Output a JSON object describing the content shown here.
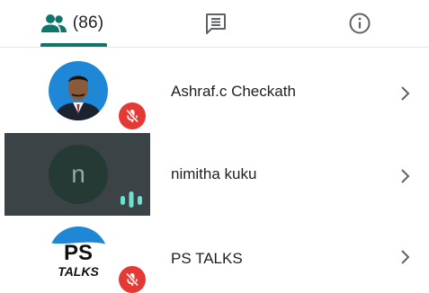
{
  "tabs": {
    "people": {
      "count_label": "(86)",
      "icon": "people-icon",
      "selected": true
    },
    "chat": {
      "icon": "chat-icon"
    },
    "info": {
      "icon": "info-icon"
    }
  },
  "colors": {
    "accent": "#11766a",
    "mic_muted": "#e53935",
    "speaking": "#6fe0d2",
    "speaking_tile": "#3b4346"
  },
  "participants": [
    {
      "name": "Ashraf.c Checkath",
      "avatar": "photo",
      "mic": "muted"
    },
    {
      "name": "nimitha kuku",
      "initial": "n",
      "mic": "speaking",
      "active_speaker": true
    },
    {
      "name": "PS TALKS",
      "avatar": "logo",
      "logo_text": [
        "PS",
        "TALKS"
      ],
      "mic": "muted"
    }
  ]
}
